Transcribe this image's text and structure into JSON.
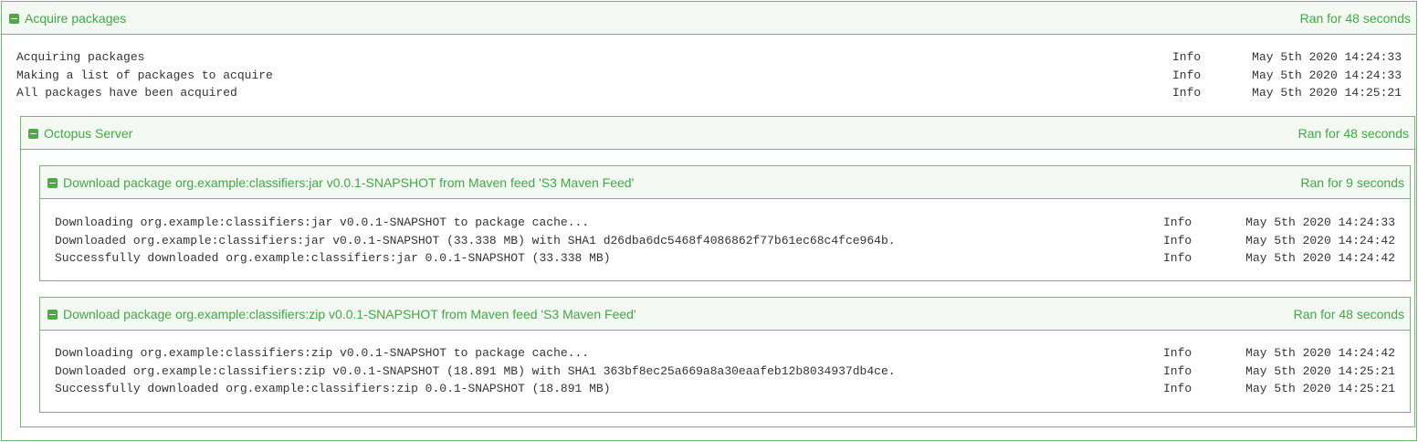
{
  "accent_color": "#43a843",
  "icons": {
    "collapse": "minus-square-icon"
  },
  "acquire": {
    "title": "Acquire packages",
    "duration": "Ran for 48 seconds",
    "lines": [
      {
        "message": "Acquiring packages",
        "level": "Info",
        "time": "May 5th 2020 14:24:33"
      },
      {
        "message": "Making a list of packages to acquire",
        "level": "Info",
        "time": "May 5th 2020 14:24:33"
      },
      {
        "message": "All packages have been acquired",
        "level": "Info",
        "time": "May 5th 2020 14:25:21"
      }
    ]
  },
  "server": {
    "title": "Octopus Server",
    "duration": "Ran for 48 seconds"
  },
  "jar": {
    "title": "Download package org.example:classifiers:jar v0.0.1-SNAPSHOT from Maven feed 'S3 Maven Feed'",
    "duration": "Ran for 9 seconds",
    "lines": [
      {
        "message": "Downloading org.example:classifiers:jar v0.0.1-SNAPSHOT to package cache...",
        "level": "Info",
        "time": "May 5th 2020 14:24:33"
      },
      {
        "message": "Downloaded org.example:classifiers:jar v0.0.1-SNAPSHOT (33.338 MB) with SHA1 d26dba6dc5468f4086862f77b61ec68c4fce964b.",
        "level": "Info",
        "time": "May 5th 2020 14:24:42"
      },
      {
        "message": "Successfully downloaded org.example:classifiers:jar 0.0.1-SNAPSHOT (33.338 MB)",
        "level": "Info",
        "time": "May 5th 2020 14:24:42"
      }
    ]
  },
  "zip": {
    "title": "Download package org.example:classifiers:zip v0.0.1-SNAPSHOT from Maven feed 'S3 Maven Feed'",
    "duration": "Ran for 48 seconds",
    "lines": [
      {
        "message": "Downloading org.example:classifiers:zip v0.0.1-SNAPSHOT to package cache...",
        "level": "Info",
        "time": "May 5th 2020 14:24:42"
      },
      {
        "message": "Downloaded org.example:classifiers:zip v0.0.1-SNAPSHOT (18.891 MB) with SHA1 363bf8ec25a669a8a30eaafeb12b8034937db4ce.",
        "level": "Info",
        "time": "May 5th 2020 14:25:21"
      },
      {
        "message": "Successfully downloaded org.example:classifiers:zip 0.0.1-SNAPSHOT (18.891 MB)",
        "level": "Info",
        "time": "May 5th 2020 14:25:21"
      }
    ]
  }
}
